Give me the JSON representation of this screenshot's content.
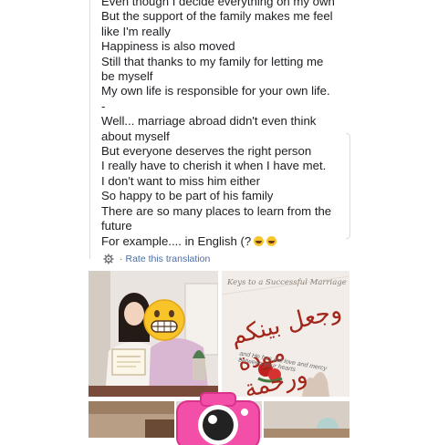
{
  "post": {
    "lines": [
      "Even though I decide everything on my own",
      "But the support of the family makes me feel",
      "like I'm really",
      "Happiness is also moved",
      "Still that thanks to my family for letting me",
      "be myself",
      "My own life is responsible for your own life.",
      "-",
      "Well... marriage abroad didn't even think",
      "about myself",
      "But everyone deserves the right person",
      "I really have to cherish it when I have met.",
      "I don't want to miss him either",
      "So happy to be part of his family",
      "There are so many places to learn from the",
      "future",
      "For example.... in English (?"
    ]
  },
  "translation": {
    "icon": "gear-icon",
    "separator": "·",
    "rate_label": "Rate this translation"
  },
  "photos": {
    "frame_title": "Keys to a Successful Marriage",
    "arabic_text": "وجعل بينكم مودة ورحمة",
    "english_caption": "and He has put love and mercy between your hearts"
  },
  "stickers": [
    "grinning-face-emoji",
    "pink-camera-sticker"
  ]
}
